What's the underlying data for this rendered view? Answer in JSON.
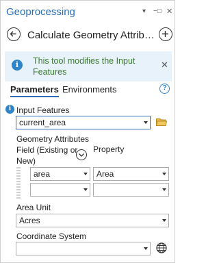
{
  "panel": {
    "title": "Geoprocessing",
    "pin_icon": "pin-icon",
    "close_icon": "close-icon"
  },
  "tool": {
    "name": "Calculate Geometry Attrib…",
    "back_icon": "back-arrow-icon",
    "add_icon": "add-icon"
  },
  "info": {
    "text": "This tool modifies the Input Features"
  },
  "tabs": {
    "parameters": "Parameters",
    "environments": "Environments"
  },
  "input_features": {
    "label": "Input Features",
    "value": "current_area"
  },
  "geometry_attributes": {
    "label": "Geometry Attributes",
    "field_header": "Field (Existing or New)",
    "property_header": "Property",
    "rows": [
      {
        "field": "area",
        "property": "Area"
      },
      {
        "field": "",
        "property": ""
      }
    ]
  },
  "area_unit": {
    "label": "Area Unit",
    "value": "Acres"
  },
  "coordinate_system": {
    "label": "Coordinate System",
    "value": ""
  },
  "colors": {
    "accent": "#2a6ebb",
    "info_bg": "#e8f2fb",
    "info_text": "#3a7a2e",
    "info_icon": "#2f83c9"
  }
}
